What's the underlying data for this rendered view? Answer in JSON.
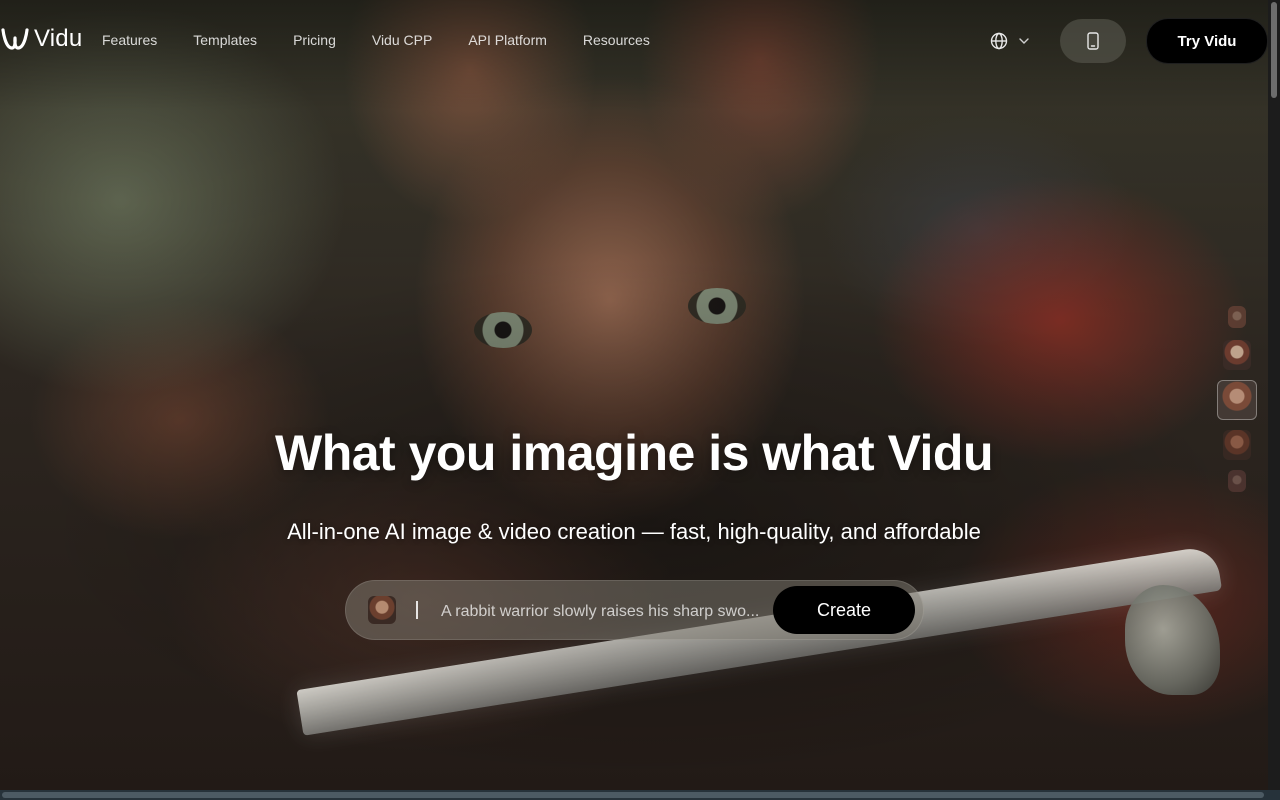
{
  "header": {
    "brand": "Vidu",
    "nav": [
      {
        "label": "Features"
      },
      {
        "label": "Templates"
      },
      {
        "label": "Pricing"
      },
      {
        "label": "Vidu CPP"
      },
      {
        "label": "API Platform"
      },
      {
        "label": "Resources"
      }
    ],
    "language_icon": "globe-icon",
    "phone_icon": "mobile-phone-icon",
    "cta_label": "Try Vidu"
  },
  "hero": {
    "title": "What you imagine is what Vidu",
    "subtitle": "All-in-one AI image & video creation — fast, high-quality, and affordable",
    "prompt": {
      "text": "A rabbit warrior slowly raises his sharp swo...",
      "button_label": "Create"
    },
    "thumbnail_count": 5
  },
  "colors": {
    "button_bg": "#000000",
    "text": "#ffffff"
  }
}
